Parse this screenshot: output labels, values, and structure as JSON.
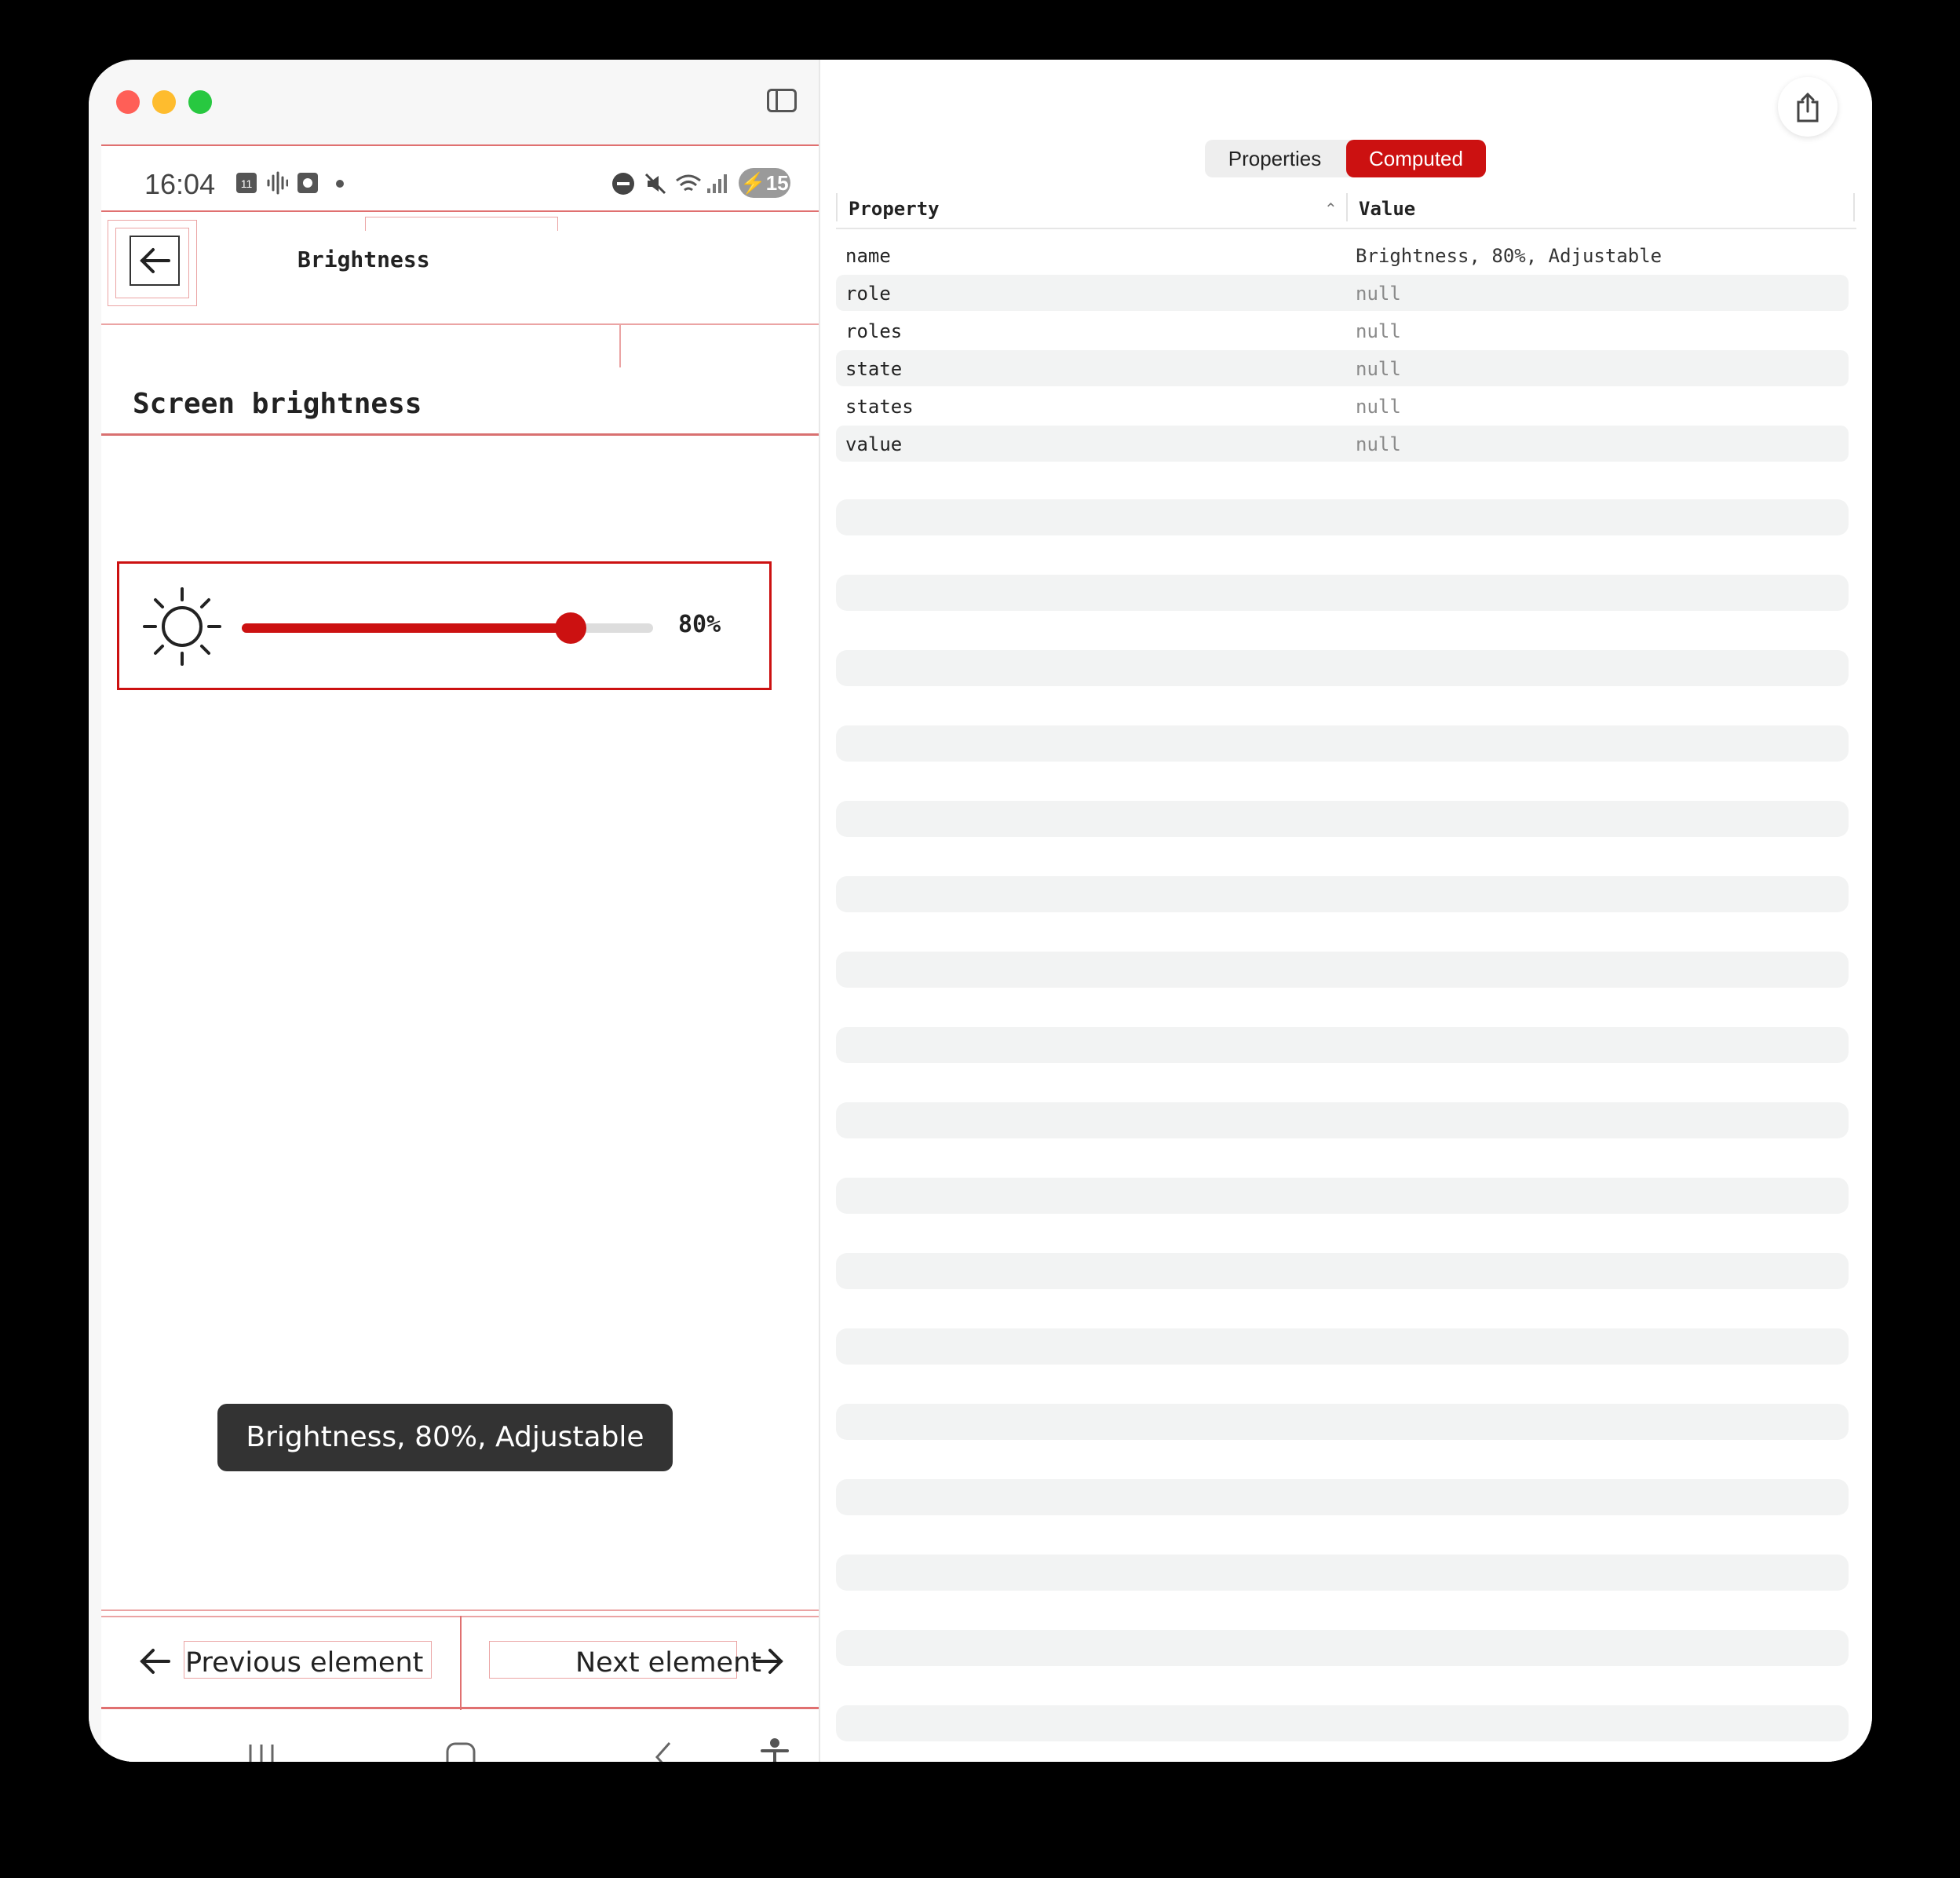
{
  "phone": {
    "status_time": "16:04",
    "calendar_day": "11",
    "battery": "15",
    "header_title": "Brightness",
    "screen_title": "Screen brightness",
    "slider": {
      "value_label": "80%",
      "level": 0.8
    },
    "toast": "Brightness, 80%, Adjustable",
    "prev_label": "Previous element",
    "next_label": "Next element"
  },
  "inspector": {
    "tabs": [
      {
        "label": "Properties",
        "active": false
      },
      {
        "label": "Computed",
        "active": true
      }
    ],
    "columns": {
      "property": "Property",
      "value": "Value"
    },
    "rows": [
      {
        "key": "name",
        "value": "Brightness, 80%, Adjustable"
      },
      {
        "key": "role",
        "value": "null"
      },
      {
        "key": "roles",
        "value": "null"
      },
      {
        "key": "state",
        "value": "null"
      },
      {
        "key": "states",
        "value": "null"
      },
      {
        "key": "value",
        "value": "null"
      }
    ]
  },
  "colors": {
    "accent": "#cc1111",
    "highlight": "#e07070"
  }
}
